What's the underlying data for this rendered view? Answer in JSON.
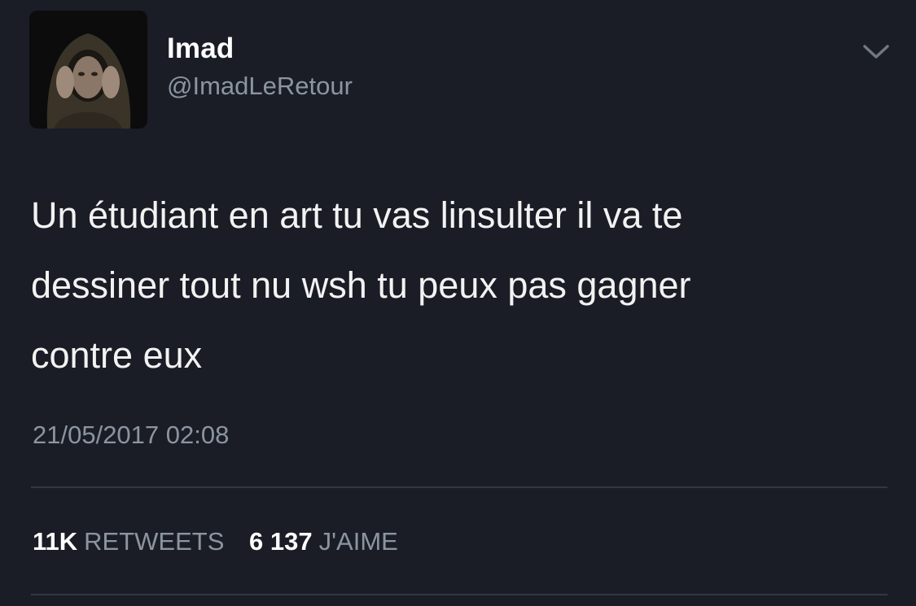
{
  "user": {
    "display_name": "Imad",
    "handle": "@ImadLeRetour"
  },
  "tweet": {
    "lines": [
      "Un étudiant en art tu vas linsulter il va te",
      "dessiner tout nu wsh tu peux pas gagner",
      "contre eux"
    ],
    "timestamp": "21/05/2017 02:08"
  },
  "stats": {
    "retweets_count": "11K",
    "retweets_label": "RETWEETS",
    "likes_count": "6 137",
    "likes_label": "J'AIME"
  },
  "icons": {
    "menu": "chevron-down-icon",
    "avatar": "avatar-hooded-figure"
  },
  "colors": {
    "background": "#1a1d26",
    "primary_text": "#ffffff",
    "secondary_text": "#8b95a1",
    "divider": "#323743"
  }
}
